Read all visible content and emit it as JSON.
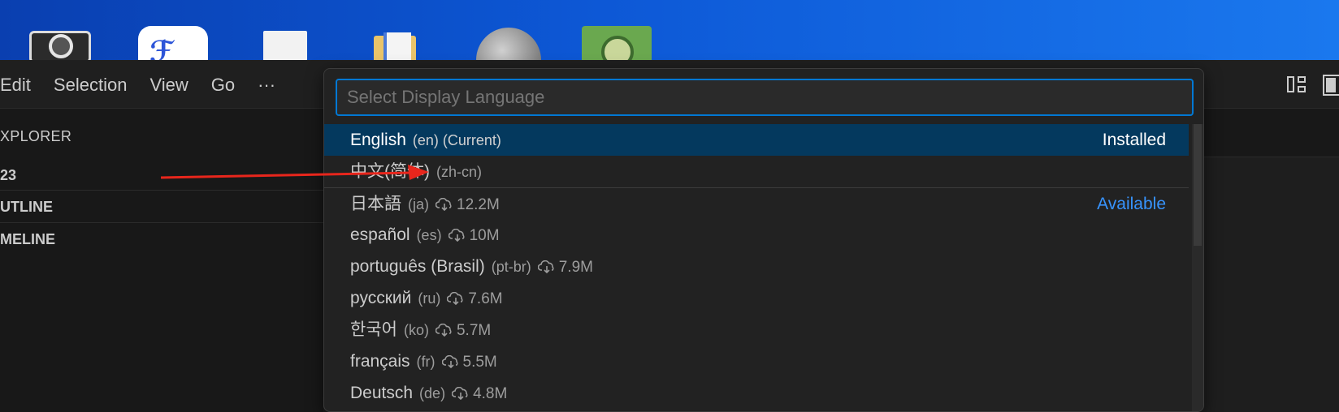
{
  "menu": {
    "items": [
      "Edit",
      "Selection",
      "View",
      "Go",
      "···"
    ]
  },
  "sidebar": {
    "explorer": "XPLORER",
    "folder": "23",
    "outline": "UTLINE",
    "timeline": "MELINE"
  },
  "quickpick": {
    "placeholder": "Select Display Language",
    "items": [
      {
        "name": "English",
        "desc": "(en) (Current)",
        "status": "Installed"
      },
      {
        "name": "中文(简体)",
        "desc": "(zh-cn)"
      },
      {
        "name": "日本語",
        "desc": "(ja)",
        "size": "12.2M",
        "status": "Available"
      },
      {
        "name": "español",
        "desc": "(es)",
        "size": "10M"
      },
      {
        "name": "português (Brasil)",
        "desc": "(pt-br)",
        "size": "7.9M"
      },
      {
        "name": "русский",
        "desc": "(ru)",
        "size": "7.6M"
      },
      {
        "name": "한국어",
        "desc": "(ko)",
        "size": "5.7M"
      },
      {
        "name": "français",
        "desc": "(fr)",
        "size": "5.5M"
      },
      {
        "name": "Deutsch",
        "desc": "(de)",
        "size": "4.8M"
      }
    ]
  },
  "colors": {
    "accent": "#0078d4",
    "selection": "#04395e",
    "available": "#3794ff",
    "annotation_arrow": "#e8261c"
  },
  "icons": [
    "cloud-download-icon",
    "layout-icon",
    "toggle-panel-icon",
    "more-icon"
  ]
}
